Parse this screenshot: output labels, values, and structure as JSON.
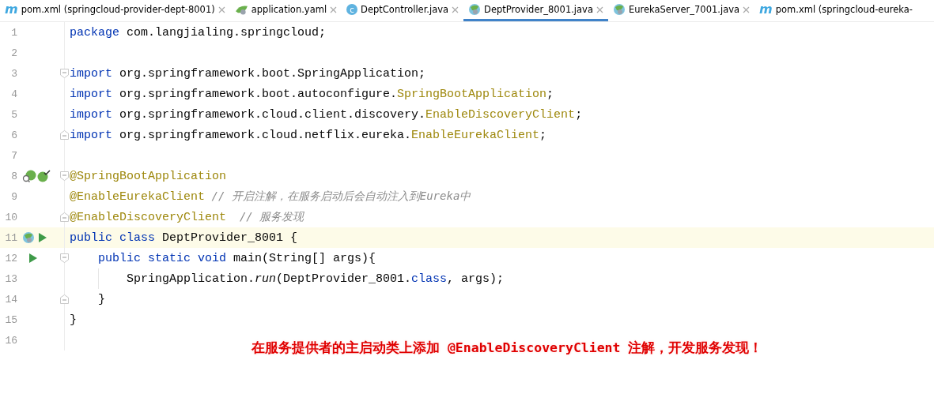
{
  "tabs": [
    {
      "kind": "maven",
      "icon_letter": "m",
      "label": "pom.xml (springcloud-provider-dept-8001)",
      "selected": false,
      "closable": true
    },
    {
      "kind": "spring-yaml",
      "label": "application.yaml",
      "selected": false,
      "closable": true
    },
    {
      "kind": "class",
      "icon_letter": "c",
      "label": "DeptController.java",
      "selected": false,
      "closable": true
    },
    {
      "kind": "spring-class",
      "label": "DeptProvider_8001.java",
      "selected": true,
      "closable": true
    },
    {
      "kind": "spring-class",
      "label": "EurekaServer_7001.java",
      "selected": false,
      "closable": true
    },
    {
      "kind": "maven",
      "icon_letter": "m",
      "label": "pom.xml (springcloud-eureka-",
      "selected": false,
      "closable": false
    }
  ],
  "lines": [
    {
      "number": "1",
      "tokens": [
        {
          "kind": "kw",
          "text": "package"
        },
        {
          "kind": "plain",
          "text": " com.langjialing.springcloud;"
        }
      ]
    },
    {
      "number": "2"
    },
    {
      "number": "3",
      "fold_start": true,
      "tokens": [
        {
          "kind": "kw",
          "text": "import"
        },
        {
          "kind": "plain",
          "text": " org.springframework.boot.SpringApplication;"
        }
      ]
    },
    {
      "number": "4",
      "tokens": [
        {
          "kind": "kw",
          "text": "import"
        },
        {
          "kind": "plain",
          "text": " org.springframework.boot.autoconfigure."
        },
        {
          "kind": "ann",
          "text": "SpringBootApplication"
        },
        {
          "kind": "plain",
          "text": ";"
        }
      ]
    },
    {
      "number": "5",
      "tokens": [
        {
          "kind": "kw",
          "text": "import"
        },
        {
          "kind": "plain",
          "text": " org.springframework.cloud.client.discovery."
        },
        {
          "kind": "ann",
          "text": "EnableDiscoveryClient"
        },
        {
          "kind": "plain",
          "text": ";"
        }
      ]
    },
    {
      "number": "6",
      "fold_end": true,
      "tokens": [
        {
          "kind": "kw",
          "text": "import"
        },
        {
          "kind": "plain",
          "text": " org.springframework.cloud.netflix.eureka."
        },
        {
          "kind": "ann",
          "text": "EnableEurekaClient"
        },
        {
          "kind": "plain",
          "text": ";"
        }
      ]
    },
    {
      "number": "7"
    },
    {
      "number": "8",
      "fold_start": true,
      "bean_icons": true,
      "tokens": [
        {
          "kind": "ann",
          "text": "@SpringBootApplication"
        }
      ]
    },
    {
      "number": "9",
      "tokens": [
        {
          "kind": "ann",
          "text": "@EnableEurekaClient"
        },
        {
          "kind": "comment",
          "text": " // 开启注解，在服务启动后会自动注入到Eureka中"
        }
      ]
    },
    {
      "number": "10",
      "fold_end": true,
      "tokens": [
        {
          "kind": "ann",
          "text": "@EnableDiscoveryClient"
        },
        {
          "kind": "comment",
          "text": "  // 服务发现"
        }
      ]
    },
    {
      "number": "11",
      "current": true,
      "spring_icon": true,
      "run_button": true,
      "tokens": [
        {
          "kind": "kw",
          "text": "public class"
        },
        {
          "kind": "plain",
          "text": " DeptProvider_8001 {"
        }
      ]
    },
    {
      "number": "12",
      "fold_start": true,
      "run_button": true,
      "tokens": [
        {
          "kind": "kw",
          "text": "    public static void"
        },
        {
          "kind": "plain",
          "text": " main(String[] args){"
        }
      ]
    },
    {
      "number": "13",
      "guide": true,
      "tokens": [
        {
          "kind": "plain",
          "text": "        SpringApplication."
        },
        {
          "kind": "italic",
          "text": "run"
        },
        {
          "kind": "plain",
          "text": "(DeptProvider_8001."
        },
        {
          "kind": "kw",
          "text": "class"
        },
        {
          "kind": "plain",
          "text": ", args);"
        }
      ]
    },
    {
      "number": "14",
      "fold_end": true,
      "tokens": [
        {
          "kind": "plain",
          "text": "    }"
        }
      ]
    },
    {
      "number": "15",
      "tokens": [
        {
          "kind": "plain",
          "text": "}"
        }
      ]
    },
    {
      "number": "16"
    }
  ],
  "callout": "在服务提供者的主启动类上添加 @EnableDiscoveryClient 注解，开发服务发现！"
}
